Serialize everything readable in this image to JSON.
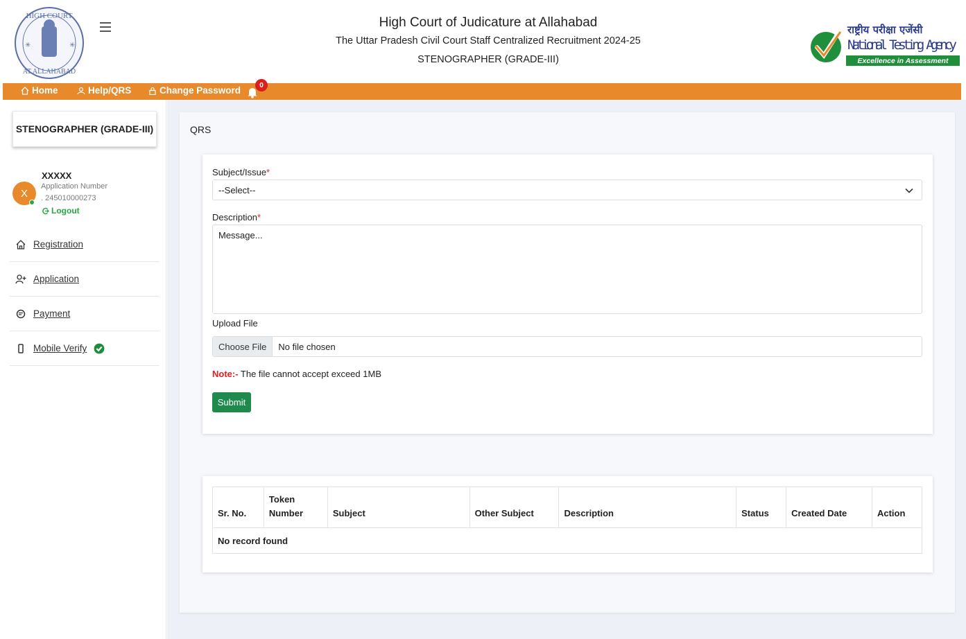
{
  "header": {
    "title": "High Court of Judicature at Allahabad",
    "subtitle": "The Uttar Pradesh Civil Court Staff Centralized Recruitment 2024-25",
    "post": "STENOGRAPHER (GRADE-III)",
    "court_logo_text_top": "HIGH COURT",
    "court_logo_text_bottom": "AT ALLAHABAD",
    "nta_hindi": "राष्ट्रीय परीक्षा एजेंसी",
    "nta_english": "National Testing Agency",
    "nta_tagline": "Excellence in Assessment"
  },
  "navbar": {
    "home": "Home",
    "help": "Help/QRS",
    "change_password": "Change Password",
    "notification_count": "0",
    "accent_color": "#e8892b"
  },
  "sidebar": {
    "post_card": "STENOGRAPHER (GRADE-III)",
    "avatar_initial": "X",
    "user_name": "XXXXX",
    "app_number_label": "Application Number",
    "app_number": ". 245010000273",
    "logout": "Logout",
    "items": [
      {
        "label": "Registration",
        "icon": "home-icon"
      },
      {
        "label": "Application",
        "icon": "user-plus-icon"
      },
      {
        "label": "Payment",
        "icon": "payment-icon"
      },
      {
        "label": "Mobile Verify",
        "icon": "mobile-icon"
      }
    ]
  },
  "main": {
    "page_title": "QRS",
    "form": {
      "subject_label": "Subject/Issue",
      "subject_value": "--Select--",
      "description_label": "Description",
      "description_placeholder": "Message...",
      "upload_label": "Upload File",
      "choose_file": "Choose File",
      "no_file": "No file chosen",
      "note_label": "Note:-",
      "note_text": " The file cannot accept exceed 1MB",
      "submit": "Submit"
    },
    "table": {
      "columns": [
        "Sr. No.",
        "Token Number",
        "Subject",
        "Other Subject",
        "Description",
        "Status",
        "Created Date",
        "Action"
      ],
      "empty_message": "No record found"
    }
  }
}
